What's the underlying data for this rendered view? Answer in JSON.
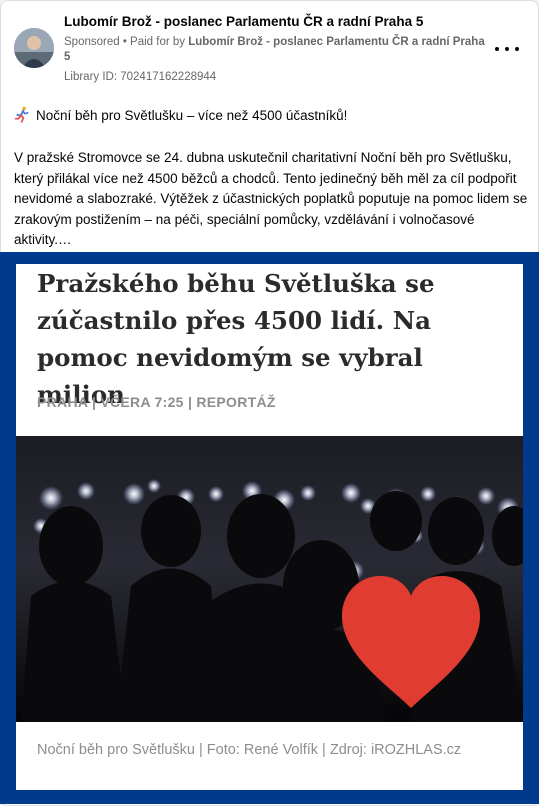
{
  "post": {
    "author": "Lubomír Brož - poslanec Parlamentu ČR a radní Praha 5",
    "sponsored_label": "Sponsored",
    "paid_prefix": " • Paid for by ",
    "paid_by": "Lubomír Brož - poslanec Parlamentu ČR a radní Praha 5",
    "library_id": "Library ID: 702417162228944",
    "title_line": "Noční běh pro Světlušku – více než 4500 účastníků!",
    "body_text": "V pražské Stromovce se 24. dubna uskutečnil charitativní Noční běh pro Světlušku, který přilákal více než 4500 běžců a chodců. Tento jedinečný běh měl za cíl podpořit nevidomé a slabozraké. Výtěžek z účastnických poplatků poputuje na pomoc lidem se zrakovým postižením – na péči, speciální pomůcky, vzdělávání i volnočasové aktivity.…"
  },
  "creative": {
    "headline": "Pražského běhu Světluška se zúčastnilo přes 4500 lidí. Na pomoc nevidomým se vybral milion",
    "kicker": "PRAHA | VČERA 7:25 | REPORTÁŽ",
    "caption": "Noční běh pro Světlušku | Foto: René Volfík | Zdroj: iROZHLAS.cz"
  },
  "icons": {
    "more": "more-options-icon",
    "runner": "runner-emoji-icon",
    "heart": "heart-icon"
  },
  "colors": {
    "frame_blue": "#003a8c",
    "heart_red": "#e03c32",
    "meta_gray": "#65676b"
  }
}
